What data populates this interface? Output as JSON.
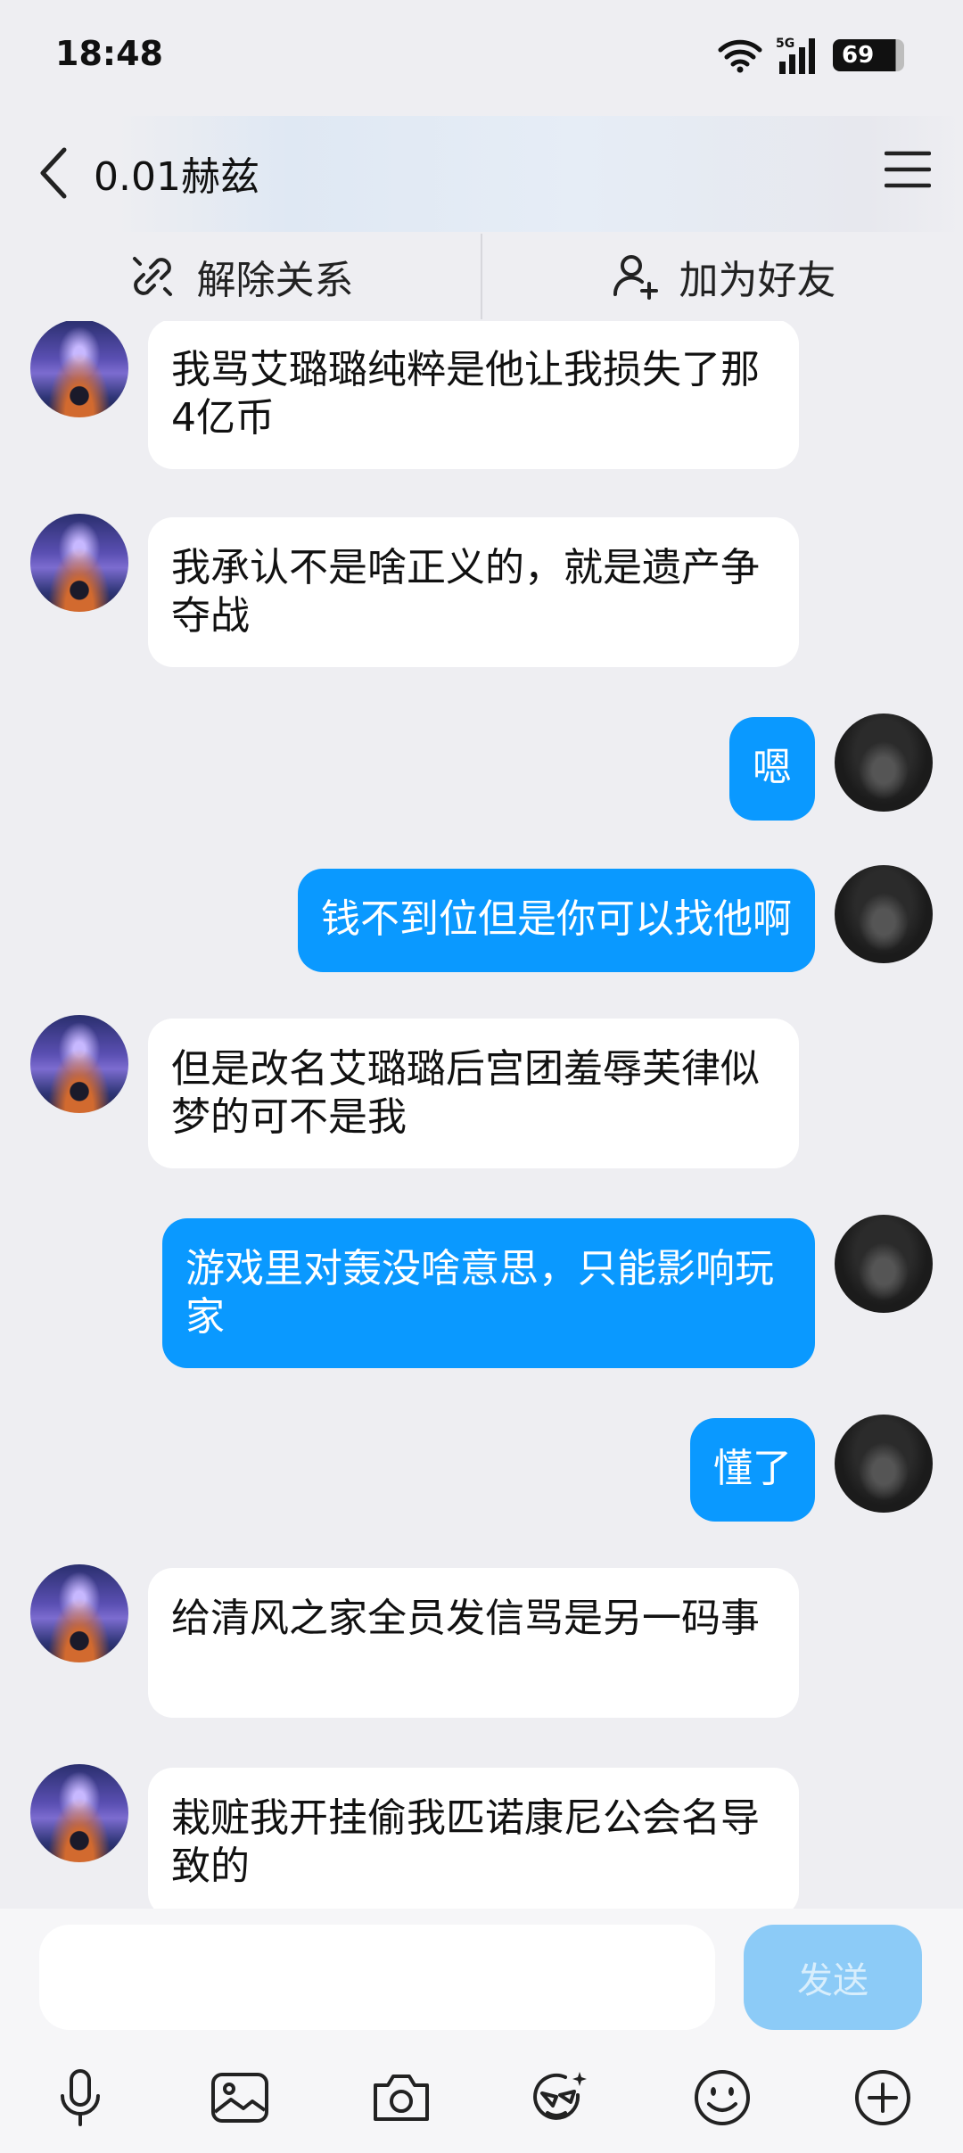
{
  "status": {
    "time": "18:48",
    "battery": "69",
    "network": "5G"
  },
  "header": {
    "title": "0.01赫兹"
  },
  "actions": {
    "unlink_label": "解除关系",
    "add_friend_label": "加为好友"
  },
  "messages": [
    {
      "from": "other",
      "text": "我骂艾璐璐纯粹是他让我损失了那4亿币"
    },
    {
      "from": "other",
      "text": "我承认不是啥正义的，就是遗产争夺战"
    },
    {
      "from": "me",
      "text": "嗯"
    },
    {
      "from": "me",
      "text": "钱不到位但是你可以找他啊"
    },
    {
      "from": "other",
      "text": "但是改名艾璐璐后宫团羞辱芙律似梦的可不是我"
    },
    {
      "from": "me",
      "text": "游戏里对轰没啥意思，只能影响玩家"
    },
    {
      "from": "me",
      "text": "懂了"
    },
    {
      "from": "other",
      "text": "给清风之家全员发信骂是另一码事"
    },
    {
      "from": "other",
      "text": "栽赃我开挂偷我匹诺康尼公会名导致的"
    }
  ],
  "input": {
    "value": "",
    "send_label": "发送"
  },
  "toolbar": {
    "icons": [
      "microphone-icon",
      "image-icon",
      "camera-icon",
      "sticker-icon",
      "emoji-icon",
      "plus-icon"
    ]
  },
  "colors": {
    "my_bubble": "#0a99ff",
    "send_disabled": "#8ccbf7",
    "background": "#eeeef2"
  }
}
